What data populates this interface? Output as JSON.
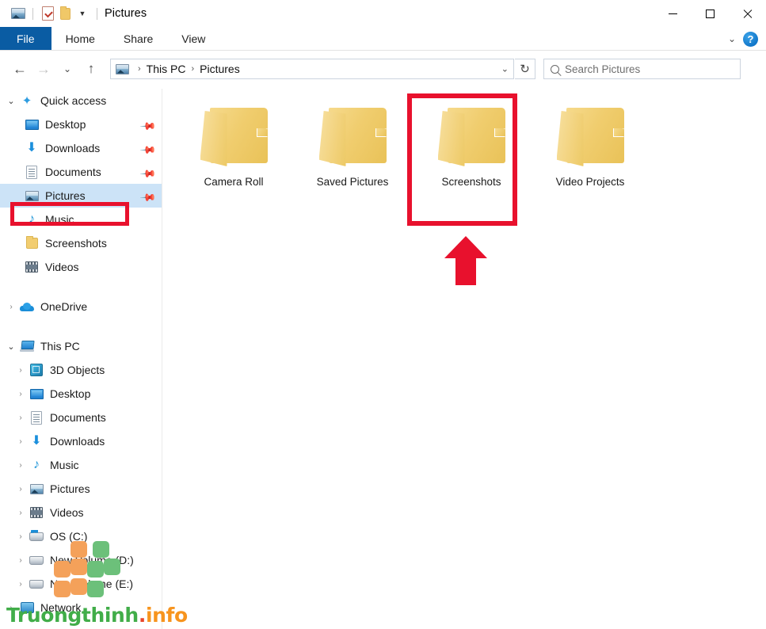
{
  "window": {
    "title": "Pictures",
    "quick_access_toolbar": [
      {
        "name": "pictures-properties-icon",
        "icon": "picture-icon"
      },
      {
        "name": "properties-icon",
        "icon": "checked-clipboard-icon"
      },
      {
        "name": "new-folder-icon",
        "icon": "folder-icon"
      },
      {
        "name": "customize-qat-icon",
        "icon": "chevron-down-icon"
      }
    ],
    "controls": {
      "minimize": "–",
      "maximize": "□",
      "close": "×"
    }
  },
  "ribbon": {
    "tabs": [
      {
        "label": "File",
        "active": true
      },
      {
        "label": "Home",
        "active": false
      },
      {
        "label": "Share",
        "active": false
      },
      {
        "label": "View",
        "active": false
      }
    ],
    "expand_icon": "⌄",
    "help_icon": "?"
  },
  "navigation": {
    "back_icon": "←",
    "forward_icon": "→",
    "recent_icon": "⌄",
    "up_icon": "↑",
    "refresh_icon": "↻",
    "dropdown_icon": "⌄",
    "breadcrumb": {
      "separator": "›",
      "items": [
        "This PC",
        "Pictures"
      ]
    }
  },
  "search": {
    "placeholder": "Search Pictures",
    "value": ""
  },
  "sidebar": {
    "groups": [
      {
        "name": "quick-access",
        "label": "Quick access",
        "expander": "⌄",
        "expanded": true,
        "icon": "star-pin-icon",
        "items": [
          {
            "label": "Desktop",
            "icon": "desktop-icon",
            "pinned": true,
            "selected": false
          },
          {
            "label": "Downloads",
            "icon": "download-icon",
            "pinned": true,
            "selected": false
          },
          {
            "label": "Documents",
            "icon": "document-icon",
            "pinned": true,
            "selected": false
          },
          {
            "label": "Pictures",
            "icon": "picture-icon",
            "pinned": true,
            "selected": true
          },
          {
            "label": "Music",
            "icon": "music-note-icon",
            "pinned": false,
            "selected": false
          },
          {
            "label": "Screenshots",
            "icon": "folder-icon",
            "pinned": false,
            "selected": false
          },
          {
            "label": "Videos",
            "icon": "video-icon",
            "pinned": false,
            "selected": false
          }
        ]
      },
      {
        "name": "onedrive",
        "label": "OneDrive",
        "expander": "›",
        "expanded": false,
        "icon": "cloud-icon",
        "items": []
      },
      {
        "name": "this-pc",
        "label": "This PC",
        "expander": "⌄",
        "expanded": true,
        "icon": "computer-icon",
        "items": [
          {
            "label": "3D Objects",
            "icon": "cube-icon",
            "expander": "›"
          },
          {
            "label": "Desktop",
            "icon": "desktop-icon",
            "expander": "›"
          },
          {
            "label": "Documents",
            "icon": "document-icon",
            "expander": "›"
          },
          {
            "label": "Downloads",
            "icon": "download-icon",
            "expander": "›"
          },
          {
            "label": "Music",
            "icon": "music-note-icon",
            "expander": "›"
          },
          {
            "label": "Pictures",
            "icon": "picture-icon",
            "expander": "›"
          },
          {
            "label": "Videos",
            "icon": "video-icon",
            "expander": "›"
          },
          {
            "label": "OS (C:)",
            "icon": "os-drive-icon",
            "expander": "›"
          },
          {
            "label": "New Volume (D:)",
            "icon": "drive-icon",
            "expander": "›"
          },
          {
            "label": "New Volume (E:)",
            "icon": "drive-icon",
            "expander": "›"
          }
        ]
      },
      {
        "name": "network",
        "label": "Network",
        "expander": "›",
        "expanded": false,
        "icon": "network-icon",
        "items": []
      }
    ]
  },
  "main": {
    "folders": [
      {
        "label": "Camera Roll",
        "highlighted": false
      },
      {
        "label": "Saved Pictures",
        "highlighted": false
      },
      {
        "label": "Screenshots",
        "highlighted": true
      },
      {
        "label": "Video Projects",
        "highlighted": false
      }
    ]
  },
  "annotations": {
    "color": "#e8112d",
    "folder_box_target": "Screenshots",
    "sidebar_box_target": "Pictures",
    "arrow_direction": "up",
    "arrow_points_to": "Screenshots"
  },
  "watermark": {
    "part_green": "Truongthinh",
    "part_dot": ".",
    "part_orange": "info",
    "colors": {
      "green": "#41ad49",
      "dot": "#e8442a",
      "orange": "#f7941e"
    }
  },
  "theme": {
    "file_tab_blue": "#0a5ca3",
    "selection_blue": "#cce3f7",
    "annotation_red": "#e8112d",
    "folder_yellow": "#f0cd6e"
  }
}
